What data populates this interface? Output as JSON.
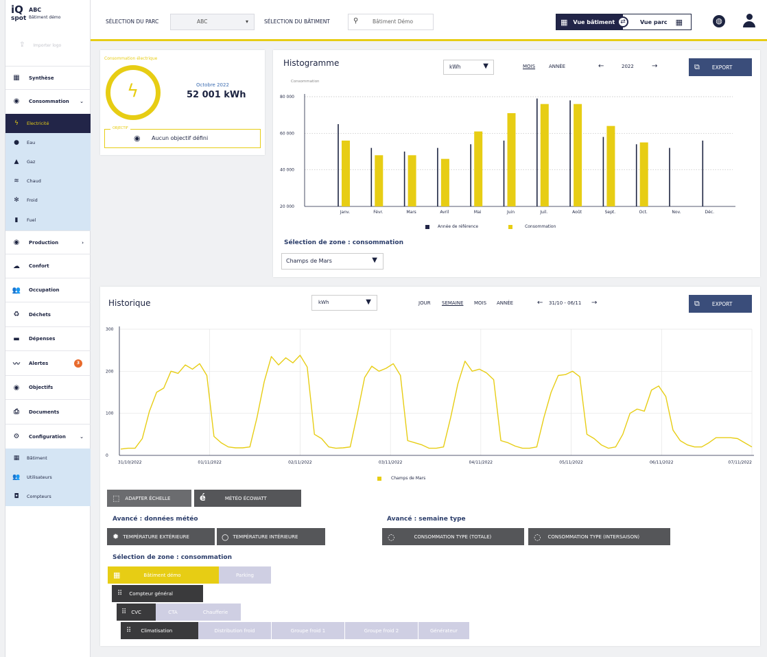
{
  "brand": {
    "logo_top": "iQ",
    "logo_bottom": "spot",
    "park_name": "ABC",
    "building_name": "Bâtiment démo",
    "import_logo": "Importer logo"
  },
  "sidebar": {
    "items": [
      {
        "key": "synthese",
        "label": "Synthèse",
        "icon": "grid-icon"
      },
      {
        "key": "consommation",
        "label": "Consommation",
        "icon": "target-icon"
      },
      {
        "key": "production",
        "label": "Production",
        "icon": "target-icon"
      },
      {
        "key": "confort",
        "label": "Confort",
        "icon": "cloud-icon"
      },
      {
        "key": "occupation",
        "label": "Occupation",
        "icon": "people-icon"
      },
      {
        "key": "dechets",
        "label": "Déchets",
        "icon": "recycle-icon"
      },
      {
        "key": "depenses",
        "label": "Dépenses",
        "icon": "card-icon"
      },
      {
        "key": "alertes",
        "label": "Alertes",
        "icon": "pulse-icon",
        "badge": "3"
      },
      {
        "key": "objectifs",
        "label": "Objectifs",
        "icon": "target-icon"
      },
      {
        "key": "documents",
        "label": "Documents",
        "icon": "paperclip-icon"
      },
      {
        "key": "configuration",
        "label": "Configuration",
        "icon": "gear-icon"
      }
    ],
    "consommation_sub": [
      "Electricité",
      "Eau",
      "Gaz",
      "Chaud",
      "Froid",
      "Fuel"
    ],
    "configuration_sub": [
      "Bâtiment",
      "Utilisateurs",
      "Compteurs"
    ]
  },
  "header": {
    "parc_label": "SÉLECTION DU PARC",
    "parc_value": "ABC",
    "batiment_label": "SÉLECTION DU BÂTIMENT",
    "batiment_value": "Bâtiment Démo",
    "vue_batiment": "Vue bâtiment",
    "vue_parc": "Vue parc"
  },
  "summary": {
    "title": "Consommation électrique",
    "period": "Octobre 2022",
    "value": "52 001 kWh",
    "objectif_label": "OBJECTIF",
    "objectif_value": "Aucun objectif défini"
  },
  "histogramme": {
    "title": "Histogramme",
    "unit": "kWh",
    "mois": "MOIS",
    "annee": "ANNÉE",
    "year": "2022",
    "export": "EXPORT",
    "ylabel": "Consommation",
    "legend_ref": "Année de référence",
    "legend_cons": "Consommation",
    "zone_title": "Sélection de zone : consommation",
    "zone_value": "Champs de Mars"
  },
  "historique": {
    "title": "Historique",
    "unit": "kWh",
    "jour": "JOUR",
    "semaine": "SEMAINE",
    "mois": "MOIS",
    "annee": "ANNÉE",
    "range": "31/10 - 06/11",
    "export": "EXPORT",
    "legend": "Champs de Mars"
  },
  "controls": {
    "adapter": "ADAPTER ÉCHELLE",
    "meteo": "MÉTÉO ÉCOWATT",
    "meteo_title": "Avancé : données météo",
    "temp_ext": "TEMPÉRATURE EXTÉRIEURE",
    "temp_int": "TEMPÉRATURE INTÉRIEURE",
    "semaine_title": "Avancé : semaine type",
    "cons_totale": "CONSOMMATION TYPE (TOTALE)",
    "cons_inter": "CONSOMMATION TYPE (INTERSAISON)",
    "zone_title": "Sélection de zone : consommation",
    "zones_l1": [
      "Bâtiment démo",
      "Parking"
    ],
    "zones_l2": [
      "Compteur général"
    ],
    "zones_l3": [
      "CVC",
      "CTA",
      "Chaufferie"
    ],
    "zones_l4": [
      "Climatisation",
      "Distribution froid",
      "Groupe froid 1",
      "Groupe froid 2",
      "Générateur"
    ]
  },
  "colors": {
    "accent": "#e7cd14",
    "navy": "#222548",
    "steel": "#3a4d7a",
    "light_blue": "#d5e5f4",
    "lavender": "#cfcfe3"
  },
  "chart_data": [
    {
      "type": "bar",
      "categories": [
        "Janv.",
        "Févr.",
        "Mars",
        "Avril",
        "Mai",
        "Juin",
        "Juil.",
        "Août",
        "Sept.",
        "Oct.",
        "Nov.",
        "Déc."
      ],
      "series": [
        {
          "name": "Année de référence",
          "values": [
            65000,
            52000,
            50000,
            52000,
            54000,
            56000,
            79000,
            78000,
            58000,
            54000,
            52000,
            56000
          ]
        },
        {
          "name": "Consommation",
          "values": [
            56000,
            48000,
            48000,
            46000,
            61000,
            71000,
            76000,
            76000,
            64000,
            55000,
            null,
            null
          ]
        }
      ],
      "ylabel": "Consommation",
      "ylim": [
        20000,
        80000
      ],
      "yticks": [
        "20 000",
        "40 000",
        "60 000",
        "80 000"
      ],
      "grid": true,
      "legend": "bottom"
    },
    {
      "type": "line",
      "x_labels": [
        "31/10/2022",
        "01/11/2022",
        "02/11/2022",
        "03/11/2022",
        "04/11/2022",
        "05/11/2022",
        "06/11/2022",
        "07/11/2022"
      ],
      "ylim": [
        0,
        300
      ],
      "yticks": [
        "0",
        "100",
        "200",
        "300"
      ],
      "series": [
        {
          "name": "Champs de Mars",
          "values": [
            15,
            17,
            17,
            40,
            105,
            150,
            160,
            200,
            195,
            215,
            205,
            218,
            190,
            45,
            30,
            20,
            18,
            18,
            20,
            90,
            175,
            235,
            215,
            232,
            220,
            238,
            210,
            50,
            40,
            20,
            17,
            18,
            20,
            100,
            185,
            212,
            200,
            207,
            218,
            190,
            35,
            30,
            25,
            17,
            17,
            20,
            90,
            170,
            224,
            200,
            205,
            196,
            180,
            35,
            30,
            22,
            17,
            17,
            20,
            90,
            150,
            190,
            192,
            200,
            187,
            50,
            40,
            25,
            17,
            20,
            50,
            100,
            110,
            105,
            155,
            165,
            140,
            60,
            35,
            25,
            20,
            20,
            30,
            42,
            42,
            42,
            40,
            30,
            20
          ]
        }
      ],
      "grid": true,
      "legend": "bottom"
    }
  ]
}
